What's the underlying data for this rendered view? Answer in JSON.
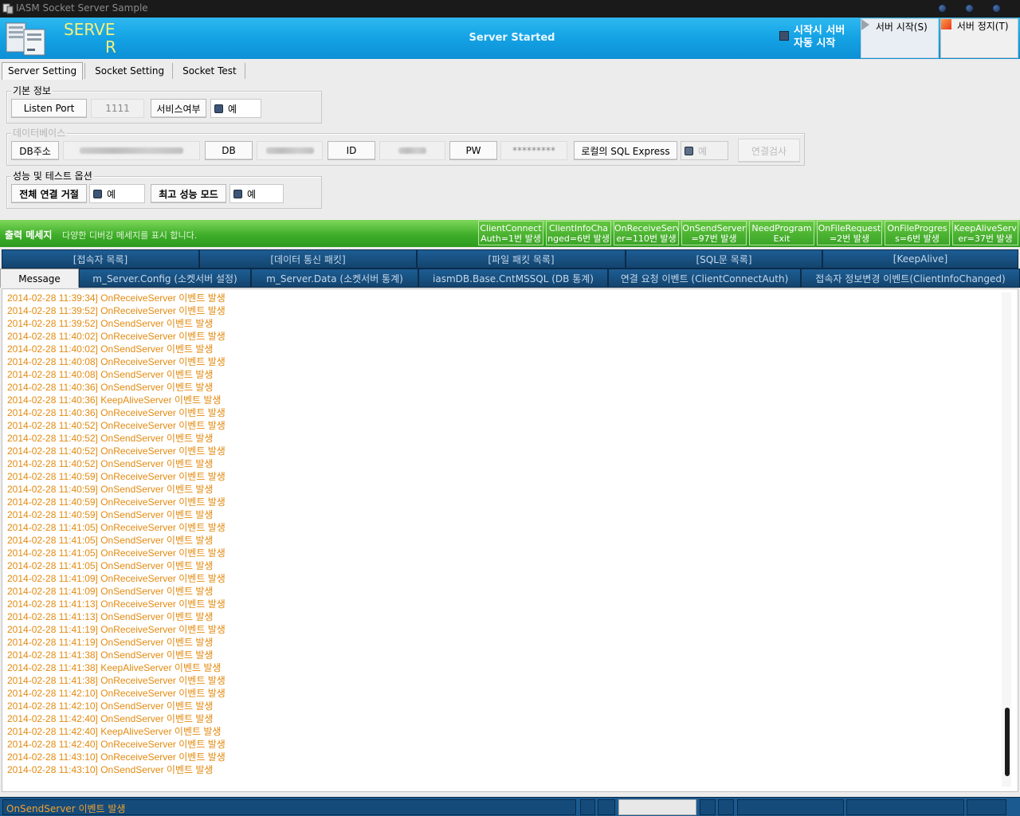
{
  "window": {
    "title": "IASM Socket Server Sample"
  },
  "banner": {
    "logo_line1": "SERVE",
    "logo_line2": "R",
    "status": "Server Started",
    "auto_start_label": "시작시 서버 자동 시작",
    "start_button": "서버 시작(S)",
    "stop_button": "서버 정지(T)"
  },
  "tabs": [
    "Server Setting",
    "Socket Setting",
    "Socket Test"
  ],
  "basic": {
    "title": "기본 정보",
    "listen_port_label": "Listen Port",
    "listen_port_value": "1111",
    "service_label": "서비스여부",
    "service_check": "예"
  },
  "database": {
    "title": "데이터베이스",
    "db_address_label": "DB주소",
    "db_label": "DB",
    "id_label": "ID",
    "pw_label": "PW",
    "pw_value": "*********",
    "local_sql_label": "로컬의 SQL Express",
    "local_sql_check": "예",
    "test_button": "연결검사"
  },
  "perf": {
    "title": "성능 및 테스트 옵션",
    "reject_label": "전체 연결 거절",
    "reject_check": "예",
    "max_perf_label": "최고 성능 모드",
    "max_perf_check": "예"
  },
  "output": {
    "title": "출력 메세지",
    "description": "다양한 디버깅 메세지를 표시 합니다.",
    "counters": [
      {
        "l1": "ClientConnect",
        "l2": "Auth=1번 발생"
      },
      {
        "l1": "ClientInfoCha",
        "l2": "nged=6번 발생"
      },
      {
        "l1": "OnReceiveServ",
        "l2": "er=110번 발생"
      },
      {
        "l1": "OnSendServer",
        "l2": "=97번 발생"
      },
      {
        "l1": "NeedProgram",
        "l2": "Exit"
      },
      {
        "l1": "OnFileRequest",
        "l2": "=2번 발생"
      },
      {
        "l1": "OnFileProgres",
        "l2": "s=6번 발생"
      },
      {
        "l1": "KeepAliveServ",
        "l2": "er=37번 발생"
      }
    ]
  },
  "inner_tabs_row1": [
    "[접속자 목록]",
    "[데이터 통신 패킷]",
    "[파일 패킷 목록]",
    "[SQL문 목록]",
    "[KeepAlive]"
  ],
  "inner_tabs_row2": [
    "Message",
    "m_Server.Config (소켓서버 설정)",
    "m_Server.Data  (소켓서버 통계)",
    "iasmDB.Base.CntMSSQL  (DB 통계)",
    "연결 요청 이벤트 (ClientConnectAuth)",
    "접속자 정보변경 이벤트(ClientInfoChanged)"
  ],
  "log": [
    "2014-02-28 11:39:34] OnReceiveServer 이벤트 발생",
    "2014-02-28 11:39:52] OnReceiveServer 이벤트 발생",
    "2014-02-28 11:39:52] OnSendServer 이벤트 발생",
    "2014-02-28 11:40:02] OnReceiveServer 이벤트 발생",
    "2014-02-28 11:40:02] OnSendServer 이벤트 발생",
    "2014-02-28 11:40:08] OnReceiveServer 이벤트 발생",
    "2014-02-28 11:40:08] OnSendServer 이벤트 발생",
    "2014-02-28 11:40:36] OnSendServer 이벤트 발생",
    "2014-02-28 11:40:36] KeepAliveServer 이벤트 발생",
    "2014-02-28 11:40:36] OnReceiveServer 이벤트 발생",
    "2014-02-28 11:40:52] OnReceiveServer 이벤트 발생",
    "2014-02-28 11:40:52] OnSendServer 이벤트 발생",
    "2014-02-28 11:40:52] OnReceiveServer 이벤트 발생",
    "2014-02-28 11:40:52] OnSendServer 이벤트 발생",
    "2014-02-28 11:40:59] OnReceiveServer 이벤트 발생",
    "2014-02-28 11:40:59] OnSendServer 이벤트 발생",
    "2014-02-28 11:40:59] OnReceiveServer 이벤트 발생",
    "2014-02-28 11:40:59] OnSendServer 이벤트 발생",
    "2014-02-28 11:41:05] OnReceiveServer 이벤트 발생",
    "2014-02-28 11:41:05] OnSendServer 이벤트 발생",
    "2014-02-28 11:41:05] OnReceiveServer 이벤트 발생",
    "2014-02-28 11:41:05] OnSendServer 이벤트 발생",
    "2014-02-28 11:41:09] OnReceiveServer 이벤트 발생",
    "2014-02-28 11:41:09] OnSendServer 이벤트 발생",
    "2014-02-28 11:41:13] OnReceiveServer 이벤트 발생",
    "2014-02-28 11:41:13] OnSendServer 이벤트 발생",
    "2014-02-28 11:41:19] OnReceiveServer 이벤트 발생",
    "2014-02-28 11:41:19] OnSendServer 이벤트 발생",
    "2014-02-28 11:41:38] OnSendServer 이벤트 발생",
    "2014-02-28 11:41:38] KeepAliveServer 이벤트 발생",
    "2014-02-28 11:41:38] OnReceiveServer 이벤트 발생",
    "2014-02-28 11:42:10] OnReceiveServer 이벤트 발생",
    "2014-02-28 11:42:10] OnSendServer 이벤트 발생",
    "2014-02-28 11:42:40] OnSendServer 이벤트 발생",
    "2014-02-28 11:42:40] KeepAliveServer 이벤트 발생",
    "2014-02-28 11:42:40] OnReceiveServer 이벤트 발생",
    "2014-02-28 11:43:10] OnReceiveServer 이벤트 발생",
    "2014-02-28 11:43:10] OnSendServer 이벤트 발생"
  ],
  "statusbar": {
    "message": "OnSendServer 이벤트 발생"
  }
}
